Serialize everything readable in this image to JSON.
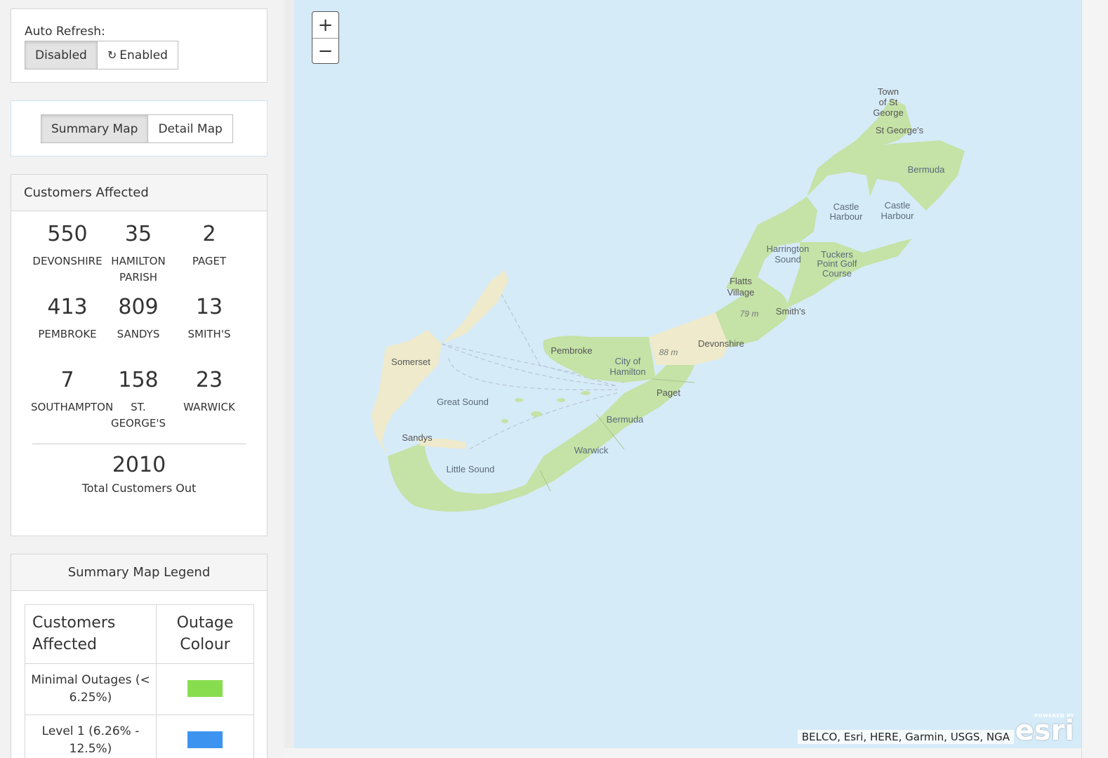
{
  "auto_refresh": {
    "label": "Auto Refresh:",
    "options": [
      "Disabled",
      "Enabled"
    ],
    "selected": "Disabled"
  },
  "map_toggle": {
    "options": [
      "Summary Map",
      "Detail Map"
    ],
    "selected": "Summary Map"
  },
  "customers_affected": {
    "title": "Customers Affected",
    "parishes": [
      {
        "count": "550",
        "name": "DEVONSHIRE"
      },
      {
        "count": "35",
        "name": "HAMILTON PARISH"
      },
      {
        "count": "2",
        "name": "PAGET"
      },
      {
        "count": "413",
        "name": "PEMBROKE"
      },
      {
        "count": "809",
        "name": "SANDYS"
      },
      {
        "count": "13",
        "name": "SMITH'S"
      },
      {
        "count": "7",
        "name": "SOUTHAMPTON"
      },
      {
        "count": "158",
        "name": "ST. GEORGE'S"
      },
      {
        "count": "23",
        "name": "WARWICK"
      }
    ],
    "total": "2010",
    "total_label": "Total Customers Out"
  },
  "legend": {
    "title": "Summary Map Legend",
    "col_customers": "Customers Affected",
    "col_colour": "Outage Colour",
    "rows": [
      {
        "label": "Minimal Outages (< 6.25%)",
        "color": "#88dd4f"
      },
      {
        "label": "Level 1 (6.26% - 12.5%)",
        "color": "#3d94f0"
      }
    ]
  },
  "map": {
    "zoom_in": "+",
    "zoom_out": "−",
    "attribution": "BELCO, Esri, HERE, Garmin, USGS, NGA",
    "esri_powered": "POWERED BY",
    "esri_brand": "esri",
    "land_color": "#c5e2a7",
    "land_highlight_color": "#eeeacb",
    "water_color": "#d6ebf8",
    "labels": {
      "town_st_george": [
        "Town",
        "of St",
        "George"
      ],
      "st_georges": "St George's",
      "bermuda_ne": "Bermuda",
      "castle_harbour_1": [
        "Castle",
        "Harbour"
      ],
      "castle_harbour_2": [
        "Castle",
        "Harbour"
      ],
      "harrington_sound": [
        "Harrington",
        "Sound"
      ],
      "tuckers_point": [
        "Tuckers",
        "Point Golf",
        "Course"
      ],
      "flatts_village": [
        "Flatts",
        "Village"
      ],
      "smiths": "Smith's",
      "elev_79": "79 m",
      "devonshire": "Devonshire",
      "elev_88": "88 m",
      "pembroke": "Pembroke",
      "city_of_hamilton": [
        "City of",
        "Hamilton"
      ],
      "paget": "Paget",
      "bermuda_mid": "Bermuda",
      "warwick": "Warwick",
      "somerset": "Somerset",
      "great_sound": "Great Sound",
      "sandys": "Sandys",
      "little_sound": "Little Sound"
    }
  }
}
